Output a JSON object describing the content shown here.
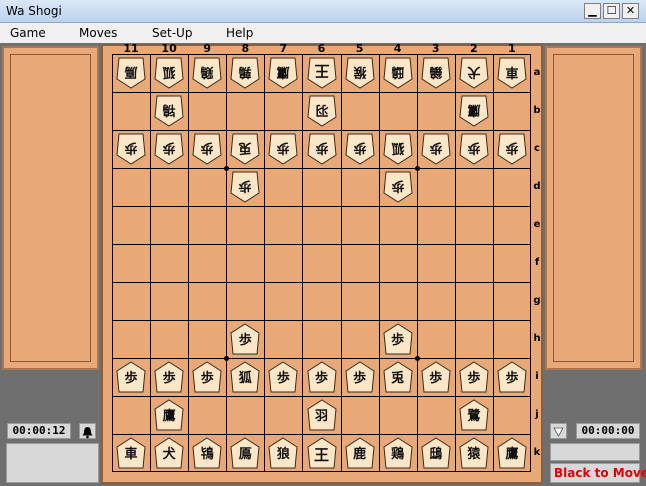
{
  "window": {
    "title": "Wa Shogi",
    "buttons": {
      "minimize": "▁",
      "maximize": "☐",
      "close": "✕"
    }
  },
  "menu": [
    "Game",
    "Moves",
    "Set-Up",
    "Help"
  ],
  "board": {
    "files": [
      "11",
      "10",
      "9",
      "8",
      "7",
      "6",
      "5",
      "4",
      "3",
      "2",
      "1"
    ],
    "ranks": [
      "a",
      "b",
      "c",
      "d",
      "e",
      "f",
      "g",
      "h",
      "i",
      "j",
      "k"
    ]
  },
  "gote": {
    "a": [
      "鳫",
      "狐",
      "鶏",
      "鶉",
      "鷹",
      "王",
      "猴",
      "鴟",
      "鶲",
      "犬",
      "車"
    ],
    "b": [
      "",
      "鴇",
      "",
      "",
      "",
      "羽",
      "",
      "",
      "",
      "鷹",
      ""
    ],
    "c": [
      "歩",
      "歩",
      "歩",
      "兎",
      "歩",
      "歩",
      "歩",
      "狐",
      "歩",
      "歩",
      "歩"
    ],
    "d": [
      "",
      "",
      "",
      "歩",
      "",
      "",
      "",
      "歩",
      "",
      "",
      ""
    ]
  },
  "sente": {
    "h": [
      "",
      "",
      "",
      "歩",
      "",
      "",
      "",
      "歩",
      "",
      "",
      ""
    ],
    "i": [
      "歩",
      "歩",
      "歩",
      "狐",
      "歩",
      "歩",
      "歩",
      "兎",
      "歩",
      "歩",
      "歩"
    ],
    "j": [
      "",
      "鷹",
      "",
      "",
      "",
      "羽",
      "",
      "",
      "",
      "鷺",
      ""
    ],
    "k": [
      "車",
      "犬",
      "鴇",
      "鳫",
      "狼",
      "王",
      "鹿",
      "鶏",
      "鴟",
      "猿",
      "鷹"
    ]
  },
  "left_panel": {
    "clock": "00:00:12",
    "bell_icon": "bell-icon"
  },
  "right_panel": {
    "clock": "00:00:00",
    "status": "Black to Move",
    "turn_icon": "triangle-down-icon"
  },
  "colors": {
    "board": "#e9a878",
    "status_text": "#e00000",
    "background": "#6f6f6f"
  }
}
